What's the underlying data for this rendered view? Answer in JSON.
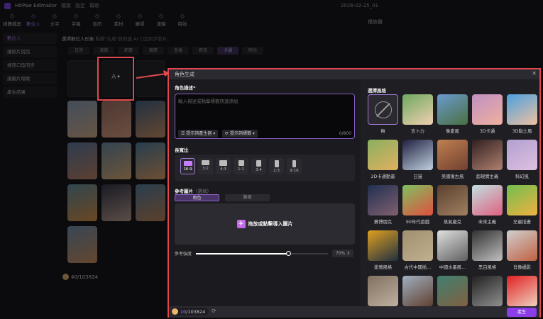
{
  "app": {
    "title": "HitPaw Edimakor",
    "menu": [
      "檔案",
      "設定",
      "幫助"
    ],
    "project": "2026-02-25_01"
  },
  "toolbar": [
    {
      "label": "媒體檔案",
      "icon": "media-icon"
    },
    {
      "label": "數位人",
      "icon": "avatar-icon"
    },
    {
      "label": "文字",
      "icon": "text-icon"
    },
    {
      "label": "字幕",
      "icon": "subtitle-icon"
    },
    {
      "label": "音訊",
      "icon": "music-icon"
    },
    {
      "label": "素材",
      "icon": "assets-icon"
    },
    {
      "label": "轉場",
      "icon": "transition-icon"
    },
    {
      "label": "濾鏡",
      "icon": "filter-icon"
    },
    {
      "label": "特效",
      "icon": "effects-icon"
    }
  ],
  "sidebar": [
    "數位人",
    "讓照片說話",
    "視訊口型同步",
    "讓圖片唱歌",
    "產生結果"
  ],
  "main": {
    "step": "選擇數位人形象",
    "hint": "點擊\"生成\"將創建 AI 口型同步影片。",
    "categories": [
      "日常",
      "演講",
      "節慶",
      "職業",
      "直播",
      "教育",
      "卡通",
      "時尚"
    ],
    "active_category": "卡通",
    "credits": "40/103824"
  },
  "player": {
    "title": "播放器"
  },
  "modal": {
    "title": "角色生成",
    "desc_label": "角色描述*",
    "desc_placeholder": "輸入描述或點擊標籤快速添加",
    "prompt_generator": "提示詞產生器",
    "prompt_tags": "提示詞標籤",
    "char_count": "0/800",
    "ratio_label": "長寬比",
    "ratios": [
      "16:9",
      "3:2",
      "4:3",
      "1:1",
      "3:4",
      "2:3",
      "9:16"
    ],
    "active_ratio": "16:9",
    "ref_label": "參考圖片",
    "ref_optional": "（選填）",
    "ref_tabs": [
      "角色",
      "臉部"
    ],
    "drop_text": "拖放或點擊導入圖片",
    "strength_label": "參考強度",
    "strength_value": 70,
    "strength_text": "70%",
    "credits_used": "10",
    "credits_total": "/103824",
    "style_label": "選擇風格",
    "styles": [
      "無",
      "吉卜力",
      "像素風",
      "3D卡通",
      "3D黏土風",
      "2D卡通動畫",
      "日漫",
      "美國復古風",
      "超現實主義",
      "科幻風",
      "賽博朋克",
      "90年代遊戲",
      "蒸氣龐克",
      "未來主義",
      "兒童插畫",
      "塗鴉風格",
      "古代中國插…",
      "中國水墨風…",
      "黑白風格",
      "肖像攝影",
      "",
      "",
      "",
      "",
      ""
    ],
    "active_style": "無",
    "generate": "產生"
  },
  "colors": {
    "accent": "#8b3ee8",
    "highlight": "#e0484d"
  }
}
